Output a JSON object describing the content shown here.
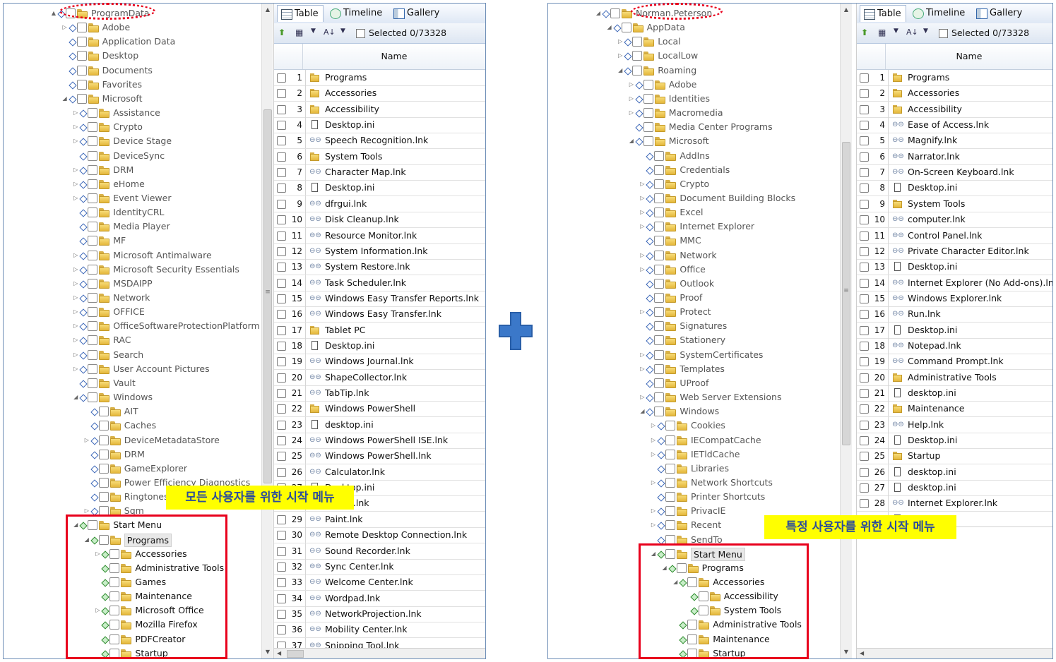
{
  "left": {
    "tree_rows": [
      {
        "label": "ProgramData",
        "level": 0,
        "expander": "▲",
        "checkbox": "blue"
      },
      {
        "label": "Adobe",
        "level": 1,
        "expander": "▷",
        "checkbox": "blue"
      },
      {
        "label": "Application Data",
        "level": 1,
        "expander": "",
        "checkbox": "blue"
      },
      {
        "label": "Desktop",
        "level": 1,
        "expander": "",
        "checkbox": "blue"
      },
      {
        "label": "Documents",
        "level": 1,
        "expander": "",
        "checkbox": "blue"
      },
      {
        "label": "Favorites",
        "level": 1,
        "expander": "",
        "checkbox": "blue"
      },
      {
        "label": "Microsoft",
        "level": 1,
        "expander": "◢",
        "checkbox": "blue"
      },
      {
        "label": "Assistance",
        "level": 2,
        "expander": "▷",
        "checkbox": "blue"
      },
      {
        "label": "Crypto",
        "level": 2,
        "expander": "▷",
        "checkbox": "blue"
      },
      {
        "label": "Device Stage",
        "level": 2,
        "expander": "▷",
        "checkbox": "blue"
      },
      {
        "label": "DeviceSync",
        "level": 2,
        "expander": "",
        "checkbox": "blue"
      },
      {
        "label": "DRM",
        "level": 2,
        "expander": "▷",
        "checkbox": "blue"
      },
      {
        "label": "eHome",
        "level": 2,
        "expander": "▷",
        "checkbox": "blue"
      },
      {
        "label": "Event Viewer",
        "level": 2,
        "expander": "▷",
        "checkbox": "blue"
      },
      {
        "label": "IdentityCRL",
        "level": 2,
        "expander": "",
        "checkbox": "blue"
      },
      {
        "label": "Media Player",
        "level": 2,
        "expander": "",
        "checkbox": "blue"
      },
      {
        "label": "MF",
        "level": 2,
        "expander": "",
        "checkbox": "blue"
      },
      {
        "label": "Microsoft Antimalware",
        "level": 2,
        "expander": "▷",
        "checkbox": "blue"
      },
      {
        "label": "Microsoft Security Essentials",
        "level": 2,
        "expander": "▷",
        "checkbox": "blue"
      },
      {
        "label": "MSDAIPP",
        "level": 2,
        "expander": "▷",
        "checkbox": "blue"
      },
      {
        "label": "Network",
        "level": 2,
        "expander": "▷",
        "checkbox": "blue"
      },
      {
        "label": "OFFICE",
        "level": 2,
        "expander": "▷",
        "checkbox": "blue"
      },
      {
        "label": "OfficeSoftwareProtectionPlatform",
        "level": 2,
        "expander": "▷",
        "checkbox": "blue"
      },
      {
        "label": "RAC",
        "level": 2,
        "expander": "▷",
        "checkbox": "blue"
      },
      {
        "label": "Search",
        "level": 2,
        "expander": "▷",
        "checkbox": "blue"
      },
      {
        "label": "User Account Pictures",
        "level": 2,
        "expander": "▷",
        "checkbox": "blue"
      },
      {
        "label": "Vault",
        "level": 2,
        "expander": "",
        "checkbox": "blue"
      },
      {
        "label": "Windows",
        "level": 2,
        "expander": "◢",
        "checkbox": "blue"
      },
      {
        "label": "AIT",
        "level": 3,
        "expander": "",
        "checkbox": "blue"
      },
      {
        "label": "Caches",
        "level": 3,
        "expander": "",
        "checkbox": "blue"
      },
      {
        "label": "DeviceMetadataStore",
        "level": 3,
        "expander": "▷",
        "checkbox": "blue"
      },
      {
        "label": "DRM",
        "level": 3,
        "expander": "",
        "checkbox": "blue"
      },
      {
        "label": "GameExplorer",
        "level": 3,
        "expander": "",
        "checkbox": "blue"
      },
      {
        "label": "Power Efficiency Diagnostics",
        "level": 3,
        "expander": "",
        "checkbox": "blue"
      },
      {
        "label": "Ringtones",
        "level": 3,
        "expander": "",
        "checkbox": "blue"
      },
      {
        "label": "Sqm",
        "level": 3,
        "expander": "▷",
        "checkbox": "blue"
      },
      {
        "label": "Start Menu",
        "level": 2,
        "expander": "◢",
        "checkbox": "green",
        "dark": true
      },
      {
        "label": "Programs",
        "level": 3,
        "expander": "◢",
        "checkbox": "green",
        "dark": true,
        "selected": true
      },
      {
        "label": "Accessories",
        "level": 4,
        "expander": "▷",
        "checkbox": "green",
        "dark": true
      },
      {
        "label": "Administrative Tools",
        "level": 4,
        "expander": "",
        "checkbox": "green",
        "dark": true
      },
      {
        "label": "Games",
        "level": 4,
        "expander": "",
        "checkbox": "green",
        "dark": true
      },
      {
        "label": "Maintenance",
        "level": 4,
        "expander": "",
        "checkbox": "green",
        "dark": true
      },
      {
        "label": "Microsoft Office",
        "level": 4,
        "expander": "▷",
        "checkbox": "green",
        "dark": true
      },
      {
        "label": "Mozilla Firefox",
        "level": 4,
        "expander": "",
        "checkbox": "green",
        "dark": true
      },
      {
        "label": "PDFCreator",
        "level": 4,
        "expander": "",
        "checkbox": "green",
        "dark": true
      },
      {
        "label": "Startup",
        "level": 4,
        "expander": "",
        "checkbox": "green",
        "dark": true
      }
    ],
    "tabs": [
      "Table",
      "Timeline",
      "Gallery"
    ],
    "selected_text": "Selected 0/73328",
    "column_name": "Name",
    "rows": [
      {
        "n": "1",
        "name": "Programs",
        "icon": "folder"
      },
      {
        "n": "2",
        "name": "Accessories",
        "icon": "folder"
      },
      {
        "n": "3",
        "name": "Accessibility",
        "icon": "folder"
      },
      {
        "n": "4",
        "name": "Desktop.ini",
        "icon": "file"
      },
      {
        "n": "5",
        "name": "Speech Recognition.lnk",
        "icon": "link"
      },
      {
        "n": "6",
        "name": "System Tools",
        "icon": "folder"
      },
      {
        "n": "7",
        "name": "Character Map.lnk",
        "icon": "link"
      },
      {
        "n": "8",
        "name": "Desktop.ini",
        "icon": "file"
      },
      {
        "n": "9",
        "name": "dfrgui.lnk",
        "icon": "link"
      },
      {
        "n": "10",
        "name": "Disk Cleanup.lnk",
        "icon": "link"
      },
      {
        "n": "11",
        "name": "Resource Monitor.lnk",
        "icon": "link"
      },
      {
        "n": "12",
        "name": "System Information.lnk",
        "icon": "link"
      },
      {
        "n": "13",
        "name": "System Restore.lnk",
        "icon": "link"
      },
      {
        "n": "14",
        "name": "Task Scheduler.lnk",
        "icon": "link"
      },
      {
        "n": "15",
        "name": "Windows Easy Transfer Reports.lnk",
        "icon": "link"
      },
      {
        "n": "16",
        "name": "Windows Easy Transfer.lnk",
        "icon": "link"
      },
      {
        "n": "17",
        "name": "Tablet PC",
        "icon": "folder"
      },
      {
        "n": "18",
        "name": "Desktop.ini",
        "icon": "file"
      },
      {
        "n": "19",
        "name": "Windows Journal.lnk",
        "icon": "link"
      },
      {
        "n": "20",
        "name": "ShapeCollector.lnk",
        "icon": "link"
      },
      {
        "n": "21",
        "name": "TabTip.lnk",
        "icon": "link"
      },
      {
        "n": "22",
        "name": "Windows PowerShell",
        "icon": "folder"
      },
      {
        "n": "23",
        "name": "desktop.ini",
        "icon": "file"
      },
      {
        "n": "24",
        "name": "Windows PowerShell ISE.lnk",
        "icon": "link"
      },
      {
        "n": "25",
        "name": "Windows PowerShell.lnk",
        "icon": "link"
      },
      {
        "n": "26",
        "name": "Calculator.lnk",
        "icon": "link"
      },
      {
        "n": "27",
        "name": "Desktop.ini",
        "icon": "file"
      },
      {
        "n": "28",
        "name": "switch.lnk",
        "icon": "link"
      },
      {
        "n": "29",
        "name": "Paint.lnk",
        "icon": "link"
      },
      {
        "n": "30",
        "name": "Remote Desktop Connection.lnk",
        "icon": "link"
      },
      {
        "n": "31",
        "name": "Sound Recorder.lnk",
        "icon": "link"
      },
      {
        "n": "32",
        "name": "Sync Center.lnk",
        "icon": "link"
      },
      {
        "n": "33",
        "name": "Welcome Center.lnk",
        "icon": "link"
      },
      {
        "n": "34",
        "name": "Wordpad.lnk",
        "icon": "link"
      },
      {
        "n": "35",
        "name": "NetworkProjection.lnk",
        "icon": "link"
      },
      {
        "n": "36",
        "name": "Mobility Center.lnk",
        "icon": "link"
      },
      {
        "n": "37",
        "name": "Snipping Tool.lnk",
        "icon": "link"
      }
    ],
    "note": "모든 사용자를 위한 시작 메뉴"
  },
  "right": {
    "tree_rows": [
      {
        "label": "Norman.Peterson",
        "level": 0,
        "expander": "◢",
        "checkbox": "blue"
      },
      {
        "label": "AppData",
        "level": 1,
        "expander": "◢",
        "checkbox": "blue"
      },
      {
        "label": "Local",
        "level": 2,
        "expander": "▷",
        "checkbox": "blue"
      },
      {
        "label": "LocalLow",
        "level": 2,
        "expander": "▷",
        "checkbox": "blue"
      },
      {
        "label": "Roaming",
        "level": 2,
        "expander": "◢",
        "checkbox": "blue"
      },
      {
        "label": "Adobe",
        "level": 3,
        "expander": "▷",
        "checkbox": "blue"
      },
      {
        "label": "Identities",
        "level": 3,
        "expander": "▷",
        "checkbox": "blue"
      },
      {
        "label": "Macromedia",
        "level": 3,
        "expander": "▷",
        "checkbox": "blue"
      },
      {
        "label": "Media Center Programs",
        "level": 3,
        "expander": "",
        "checkbox": "blue"
      },
      {
        "label": "Microsoft",
        "level": 3,
        "expander": "◢",
        "checkbox": "blue"
      },
      {
        "label": "AddIns",
        "level": 4,
        "expander": "",
        "checkbox": "blue"
      },
      {
        "label": "Credentials",
        "level": 4,
        "expander": "",
        "checkbox": "blue"
      },
      {
        "label": "Crypto",
        "level": 4,
        "expander": "▷",
        "checkbox": "blue"
      },
      {
        "label": "Document Building Blocks",
        "level": 4,
        "expander": "▷",
        "checkbox": "blue"
      },
      {
        "label": "Excel",
        "level": 4,
        "expander": "▷",
        "checkbox": "blue"
      },
      {
        "label": "Internet Explorer",
        "level": 4,
        "expander": "▷",
        "checkbox": "blue"
      },
      {
        "label": "MMC",
        "level": 4,
        "expander": "",
        "checkbox": "blue"
      },
      {
        "label": "Network",
        "level": 4,
        "expander": "▷",
        "checkbox": "blue"
      },
      {
        "label": "Office",
        "level": 4,
        "expander": "▷",
        "checkbox": "blue"
      },
      {
        "label": "Outlook",
        "level": 4,
        "expander": "",
        "checkbox": "blue"
      },
      {
        "label": "Proof",
        "level": 4,
        "expander": "",
        "checkbox": "blue"
      },
      {
        "label": "Protect",
        "level": 4,
        "expander": "▷",
        "checkbox": "blue"
      },
      {
        "label": "Signatures",
        "level": 4,
        "expander": "",
        "checkbox": "blue"
      },
      {
        "label": "Stationery",
        "level": 4,
        "expander": "",
        "checkbox": "blue"
      },
      {
        "label": "SystemCertificates",
        "level": 4,
        "expander": "▷",
        "checkbox": "blue"
      },
      {
        "label": "Templates",
        "level": 4,
        "expander": "▷",
        "checkbox": "blue"
      },
      {
        "label": "UProof",
        "level": 4,
        "expander": "",
        "checkbox": "blue"
      },
      {
        "label": "Web Server Extensions",
        "level": 4,
        "expander": "▷",
        "checkbox": "blue"
      },
      {
        "label": "Windows",
        "level": 4,
        "expander": "◢",
        "checkbox": "blue"
      },
      {
        "label": "Cookies",
        "level": 5,
        "expander": "▷",
        "checkbox": "blue"
      },
      {
        "label": "IECompatCache",
        "level": 5,
        "expander": "▷",
        "checkbox": "blue"
      },
      {
        "label": "IETldCache",
        "level": 5,
        "expander": "▷",
        "checkbox": "blue"
      },
      {
        "label": "Libraries",
        "level": 5,
        "expander": "",
        "checkbox": "blue"
      },
      {
        "label": "Network Shortcuts",
        "level": 5,
        "expander": "▷",
        "checkbox": "blue"
      },
      {
        "label": "Printer Shortcuts",
        "level": 5,
        "expander": "",
        "checkbox": "blue"
      },
      {
        "label": "PrivacIE",
        "level": 5,
        "expander": "▷",
        "checkbox": "blue"
      },
      {
        "label": "Recent",
        "level": 5,
        "expander": "▷",
        "checkbox": "blue"
      },
      {
        "label": "SendTo",
        "level": 5,
        "expander": "",
        "checkbox": "blue"
      },
      {
        "label": "Start Menu",
        "level": 5,
        "expander": "◢",
        "checkbox": "green",
        "dark": true,
        "selected": true
      },
      {
        "label": "Programs",
        "level": 6,
        "expander": "◢",
        "checkbox": "green",
        "dark": true
      },
      {
        "label": "Accessories",
        "level": 7,
        "expander": "◢",
        "checkbox": "green",
        "dark": true
      },
      {
        "label": "Accessibility",
        "level": 8,
        "expander": "",
        "checkbox": "green",
        "dark": true
      },
      {
        "label": "System Tools",
        "level": 8,
        "expander": "",
        "checkbox": "green",
        "dark": true
      },
      {
        "label": "Administrative Tools",
        "level": 7,
        "expander": "",
        "checkbox": "green",
        "dark": true
      },
      {
        "label": "Maintenance",
        "level": 7,
        "expander": "",
        "checkbox": "green",
        "dark": true
      },
      {
        "label": "Startup",
        "level": 7,
        "expander": "",
        "checkbox": "green",
        "dark": true
      }
    ],
    "tabs": [
      "Table",
      "Timeline",
      "Gallery"
    ],
    "selected_text": "Selected 0/73328",
    "column_name": "Name",
    "rows": [
      {
        "n": "1",
        "name": "Programs",
        "icon": "folder"
      },
      {
        "n": "2",
        "name": "Accessories",
        "icon": "folder"
      },
      {
        "n": "3",
        "name": "Accessibility",
        "icon": "folder"
      },
      {
        "n": "4",
        "name": "Ease of Access.lnk",
        "icon": "link"
      },
      {
        "n": "5",
        "name": "Magnify.lnk",
        "icon": "link"
      },
      {
        "n": "6",
        "name": "Narrator.lnk",
        "icon": "link"
      },
      {
        "n": "7",
        "name": "On-Screen Keyboard.lnk",
        "icon": "link"
      },
      {
        "n": "8",
        "name": "Desktop.ini",
        "icon": "file"
      },
      {
        "n": "9",
        "name": "System Tools",
        "icon": "folder"
      },
      {
        "n": "10",
        "name": "computer.lnk",
        "icon": "link"
      },
      {
        "n": "11",
        "name": "Control Panel.lnk",
        "icon": "link"
      },
      {
        "n": "12",
        "name": "Private Character Editor.lnk",
        "icon": "link"
      },
      {
        "n": "13",
        "name": "Desktop.ini",
        "icon": "file"
      },
      {
        "n": "14",
        "name": "Internet Explorer (No Add-ons).lnk",
        "icon": "link"
      },
      {
        "n": "15",
        "name": "Windows Explorer.lnk",
        "icon": "link"
      },
      {
        "n": "16",
        "name": "Run.lnk",
        "icon": "link"
      },
      {
        "n": "17",
        "name": "Desktop.ini",
        "icon": "file"
      },
      {
        "n": "18",
        "name": "Notepad.lnk",
        "icon": "link"
      },
      {
        "n": "19",
        "name": "Command Prompt.lnk",
        "icon": "link"
      },
      {
        "n": "20",
        "name": "Administrative Tools",
        "icon": "folder"
      },
      {
        "n": "21",
        "name": "desktop.ini",
        "icon": "file"
      },
      {
        "n": "22",
        "name": "Maintenance",
        "icon": "folder"
      },
      {
        "n": "23",
        "name": "Help.lnk",
        "icon": "link"
      },
      {
        "n": "24",
        "name": "Desktop.ini",
        "icon": "file"
      },
      {
        "n": "25",
        "name": "Startup",
        "icon": "folder"
      },
      {
        "n": "26",
        "name": "desktop.ini",
        "icon": "file"
      },
      {
        "n": "27",
        "name": "desktop.ini",
        "icon": "file"
      },
      {
        "n": "28",
        "name": "Internet Explorer.lnk",
        "icon": "link"
      },
      {
        "n": "29",
        "name": "desktop.ini",
        "icon": "file"
      }
    ],
    "note": "특정 사용자를 위한 시작 메뉴"
  },
  "colors": {
    "plus": "#3b78c9",
    "note_bg": "#ffff00",
    "note_text": "#2c4d9a",
    "highlight": "#e8001c",
    "panel_border": "#6f8fb7"
  }
}
